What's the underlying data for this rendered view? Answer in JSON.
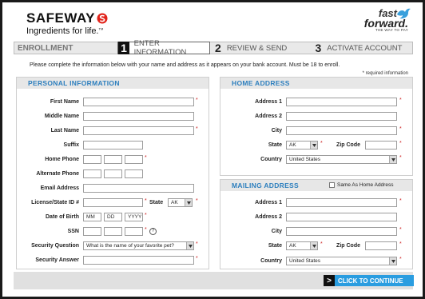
{
  "brand": {
    "name": "SAFEWAY",
    "tagline": "Ingredients for life.",
    "tm": "TM"
  },
  "fastforward": {
    "line1": "fast",
    "line2": "forward.",
    "line3": "THE WAY TO PAY"
  },
  "steps": {
    "s1": "ENROLLMENT",
    "s2_num": "1",
    "s2": "ENTER INFORMATION",
    "s3_num": "2",
    "s3": "REVIEW & SEND",
    "s4_num": "3",
    "s4": "ACTIVATE ACCOUNT"
  },
  "intro": "Please complete the information below with your name and address as it appears on your bank account. Must be 18 to enroll.",
  "required_note": "* required information",
  "personal": {
    "title": "PERSONAL INFORMATION",
    "first_name": "First Name",
    "middle_name": "Middle Name",
    "last_name": "Last Name",
    "suffix": "Suffix",
    "home_phone": "Home Phone",
    "alt_phone": "Alternate Phone",
    "email": "Email Address",
    "license": "License/State ID #",
    "state_label": "State",
    "state_value": "AK",
    "dob": "Date of Birth",
    "dob_mm": "MM",
    "dob_dd": "DD",
    "dob_yyyy": "YYYY",
    "ssn": "SSN",
    "help": "?",
    "security_q": "Security Question",
    "security_q_value": "What is the name of your favorite pet?",
    "security_a": "Security Answer"
  },
  "home": {
    "title": "HOME ADDRESS",
    "address1": "Address 1",
    "address2": "Address 2",
    "city": "City",
    "state": "State",
    "state_value": "AK",
    "zip": "Zip Code",
    "country": "Country",
    "country_value": "United States"
  },
  "mailing": {
    "title": "MAILING ADDRESS",
    "same_as_home": "Same As Home Address",
    "address1": "Address 1",
    "address2": "Address 2",
    "city": "City",
    "state": "State",
    "state_value": "AK",
    "zip": "Zip Code",
    "country": "Country",
    "country_value": "United States"
  },
  "cta": {
    "label": "CLICK TO CONTINUE",
    "arrow": ">"
  },
  "star": "*",
  "icons": {
    "dropdown": "chevron-down-icon"
  },
  "colors": {
    "accent": "#2d7fbe",
    "cta": "#2a9de0",
    "required": "#cc1f1f"
  }
}
